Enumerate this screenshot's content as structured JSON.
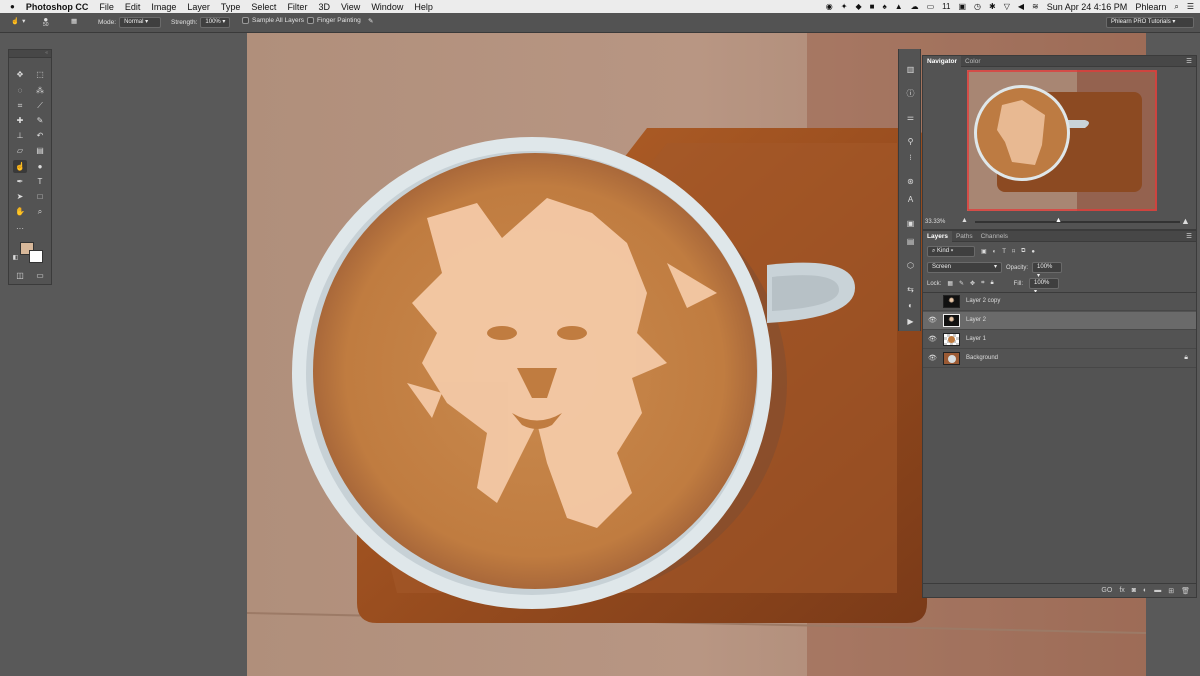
{
  "menubar": {
    "apple": "",
    "app_name": "Photoshop CC",
    "items": [
      "File",
      "Edit",
      "Image",
      "Layer",
      "Type",
      "Select",
      "Filter",
      "3D",
      "View",
      "Window",
      "Help"
    ],
    "battery": "11",
    "date_time": "Sun Apr 24  4:16 PM",
    "user": "Phlearn"
  },
  "options": {
    "brush_size": "50",
    "mode_label": "Mode:",
    "mode_value": "Normal",
    "strength_label": "Strength:",
    "strength_value": "100%",
    "sample_all_layers": "Sample All Layers",
    "finger_painting": "Finger Painting",
    "workspace": "Phlearn PRO Tutorials"
  },
  "navigator": {
    "tabs": [
      "Navigator",
      "Color"
    ],
    "zoom": "33.33%"
  },
  "layers": {
    "tabs": [
      "Layers",
      "Paths",
      "Channels"
    ],
    "filter_kind": "Kind",
    "blend_mode": "Screen",
    "opacity_label": "Opacity:",
    "opacity_value": "100%",
    "lock_label": "Lock:",
    "fill_label": "Fill:",
    "fill_value": "100%",
    "rows": [
      {
        "name": "Layer 2 copy",
        "visible": false,
        "selected": false
      },
      {
        "name": "Layer 2",
        "visible": true,
        "selected": true
      },
      {
        "name": "Layer 1",
        "visible": true,
        "selected": false
      },
      {
        "name": "Background",
        "visible": true,
        "selected": false,
        "locked": true
      }
    ],
    "footer": [
      "GO",
      "fx"
    ]
  },
  "colors": {
    "foreground": "#d8b89a",
    "background": "#ffffff",
    "accent_red": "#e23a3a"
  }
}
